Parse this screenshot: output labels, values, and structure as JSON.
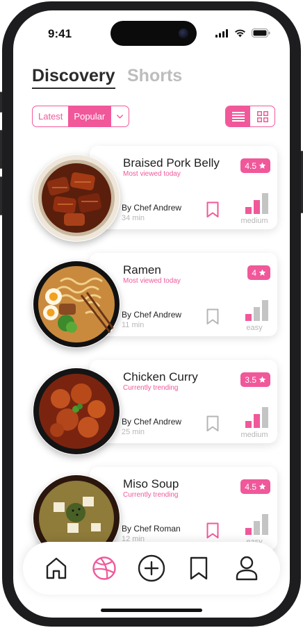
{
  "status_bar": {
    "time": "9:41"
  },
  "tabs": [
    {
      "label": "Discovery",
      "active": true
    },
    {
      "label": "Shorts",
      "active": false
    }
  ],
  "filter": {
    "options": [
      "Latest",
      "Popular"
    ],
    "selected": "Popular"
  },
  "view_toggle": {
    "options": [
      "list-view-icon",
      "grid-view-icon"
    ],
    "selected": "list-view-icon"
  },
  "recipes": [
    {
      "title": "Braised Pork Belly",
      "subtitle": "Most viewed today",
      "rating": "4.5",
      "chef": "By Chef Andrew",
      "time": "34 min",
      "difficulty": "medium",
      "difficulty_level": 2,
      "bookmarked": true
    },
    {
      "title": "Ramen",
      "subtitle": "Most viewed today",
      "rating": "4",
      "chef": "By Chef Andrew",
      "time": "11 min",
      "difficulty": "easy",
      "difficulty_level": 1,
      "bookmarked": false
    },
    {
      "title": "Chicken Curry",
      "subtitle": "Currently trending",
      "rating": "3.5",
      "chef": "By Chef Andrew",
      "time": "25 min",
      "difficulty": "medium",
      "difficulty_level": 2,
      "bookmarked": false
    },
    {
      "title": "Miso Soup",
      "subtitle": "Currently trending",
      "rating": "4.5",
      "chef": "By Chef Roman",
      "time": "12 min",
      "difficulty": "easy",
      "difficulty_level": 1,
      "bookmarked": true
    }
  ],
  "bottom_nav": {
    "items": [
      "home-icon",
      "discover-icon",
      "add-icon",
      "bookmark-icon",
      "profile-icon"
    ],
    "active": "discover-icon"
  },
  "colors": {
    "accent": "#f0589a",
    "muted": "#c4c4c4",
    "text": "#1e1e1e"
  }
}
